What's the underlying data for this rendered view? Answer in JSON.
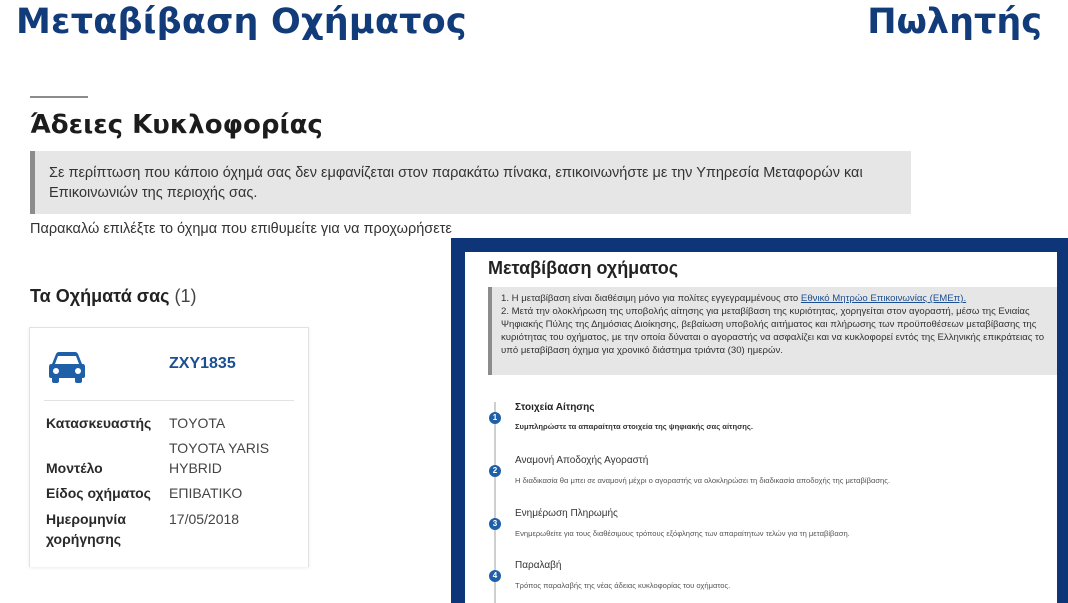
{
  "slide": {
    "title": "Μεταβίβαση Οχήματος",
    "role": "Πωλητής"
  },
  "page": {
    "heading": "Άδειες Κυκλοφορίας",
    "notice": "Σε περίπτωση που κάποιο όχημά σας δεν εμφανίζεται στον παρακάτω πίνακα, επικοινωνήστε με την Υπηρεσία Μεταφορών και Επικοινωνιών της περιοχής σας.",
    "instruction": "Παρακαλώ επιλέξτε το όχημα που επιθυμείτε για να προχωρήσετε",
    "vehicles_label": "Τα Οχήματά σας",
    "vehicles_count": "(1)"
  },
  "vehicle": {
    "icon": "car-icon",
    "plate": "ZXY1835",
    "fields": [
      {
        "key": "Κατασκευαστής",
        "value": "TOYOTA"
      },
      {
        "key": "Μοντέλο",
        "value": "TOYOTA YARIS HYBRID"
      },
      {
        "key": "Είδος οχήματος",
        "value": "ΕΠΙΒΑΤΙΚΟ"
      },
      {
        "key": "Ημερομηνία χορήγησης",
        "value": "17/05/2018"
      }
    ]
  },
  "inset": {
    "title": "Μεταβίβαση οχήματος",
    "notice_item1_prefix": "1. Η μεταβίβαση είναι διαθέσιμη μόνο για πολίτες εγγεγραμμένους στο ",
    "notice_item1_link": "Εθνικό Μητρώο Επικοινωνίας (ΕΜΕπ).",
    "notice_item2": "2. Μετά την ολοκλήρωση της υποβολής αίτησης για μεταβίβαση της κυριότητας, χορηγείται στον αγοραστή, μέσω της Ενιαίας Ψηφιακής Πύλης της Δημόσιας Διοίκησης, βεβαίωση υποβολής αιτήματος και πλήρωσης των προϋποθέσεων μεταβίβασης της κυριότητας του οχήματος, με την οποία δύναται ο αγοραστής να ασφαλίζει και να κυκλοφορεί εντός της Ελληνικής επικράτειας το υπό μεταβίβαση όχημα για χρονικό διάστημα τριάντα (30) ημερών.",
    "steps": [
      {
        "num": "1",
        "title": "Στοιχεία Αίτησης",
        "desc": "Συμπληρώστε τα απαραίτητα στοιχεία της ψηφιακής σας αίτησης."
      },
      {
        "num": "2",
        "title": "Αναμονή Αποδοχής Αγοραστή",
        "desc": "Η διαδικασία θα μπει σε αναμονή μέχρι ο αγοραστής να ολοκληρώσει τη διαδικασία αποδοχής της μεταβίβασης."
      },
      {
        "num": "3",
        "title": "Ενημέρωση Πληρωμής",
        "desc": "Ενημερωθείτε για τους διαθέσιμους τρόπους εξόφλησης των απαραίτητων τελών για τη μεταβίβαση."
      },
      {
        "num": "4",
        "title": "Παραλαβή",
        "desc": "Τρόπος παραλαβής της νέας άδειας κυκλοφορίας του οχήματος."
      }
    ]
  },
  "colors": {
    "brand": "#123b7a",
    "link": "#1b4f94",
    "step_dot": "#1f5fa8",
    "notice_bg": "#e6e6e6",
    "inset_frame": "#0d3577"
  }
}
